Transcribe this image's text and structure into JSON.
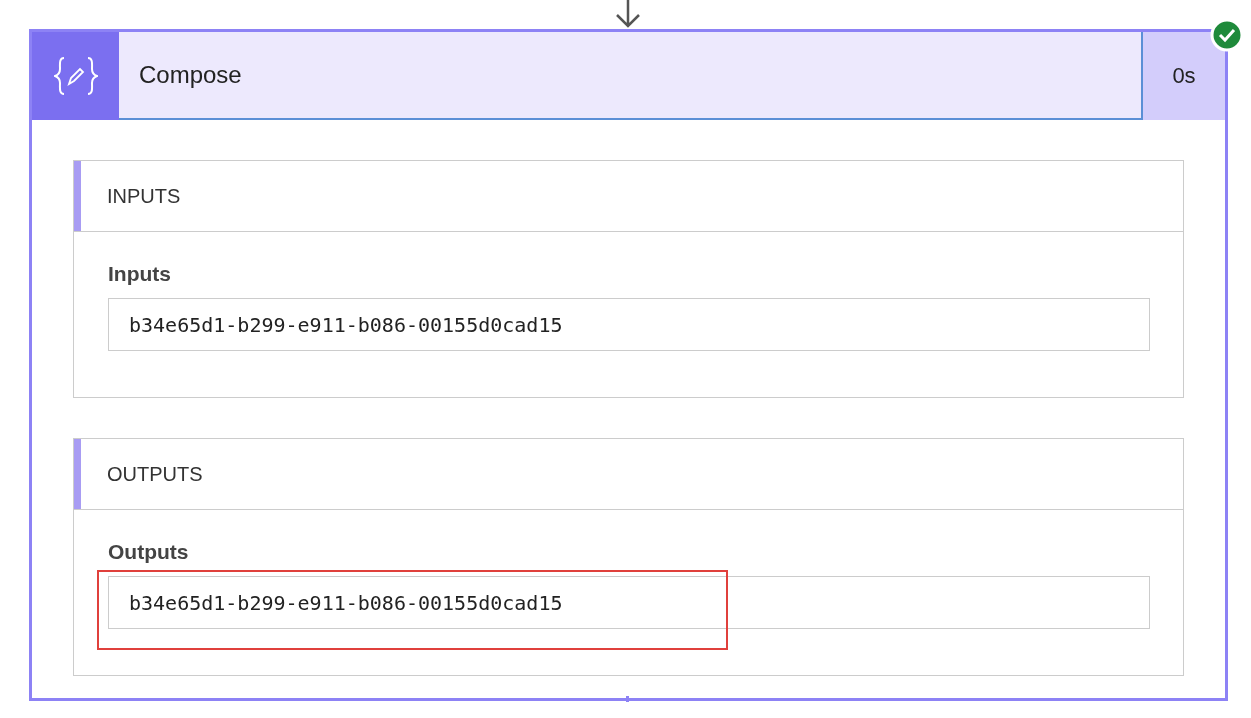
{
  "action": {
    "title": "Compose",
    "duration": "0s",
    "succeeded": true
  },
  "sections": [
    {
      "heading": "INPUTS",
      "label": "Inputs",
      "value": "b34e65d1-b299-e911-b086-00155d0cad15",
      "highlighted": false
    },
    {
      "heading": "OUTPUTS",
      "label": "Outputs",
      "value": "b34e65d1-b299-e911-b086-00155d0cad15",
      "highlighted": true
    }
  ]
}
